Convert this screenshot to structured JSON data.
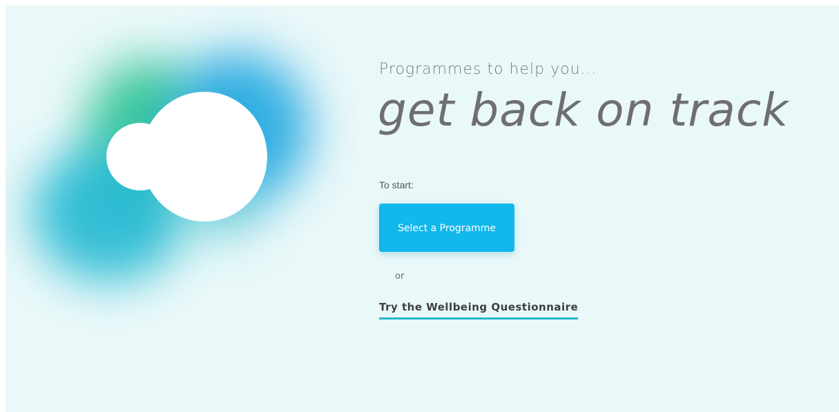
{
  "hero": {
    "art_icon": "blurred-bubbles-logo",
    "colors": {
      "green": "#22c08a",
      "blue": "#1ea6e0",
      "teal": "#14b4cf"
    }
  },
  "heading": {
    "subtitle": "Programmes to help you...",
    "title": "get back on track"
  },
  "actions": {
    "intro": "To start:",
    "primary_button": "Select a Programme",
    "separator": "or",
    "secondary_link": "Try the Wellbeing Questionnaire"
  },
  "colors": {
    "background": "#e9f8f9",
    "accent": "#12b7ec",
    "link_underline": "#26b6c9"
  }
}
